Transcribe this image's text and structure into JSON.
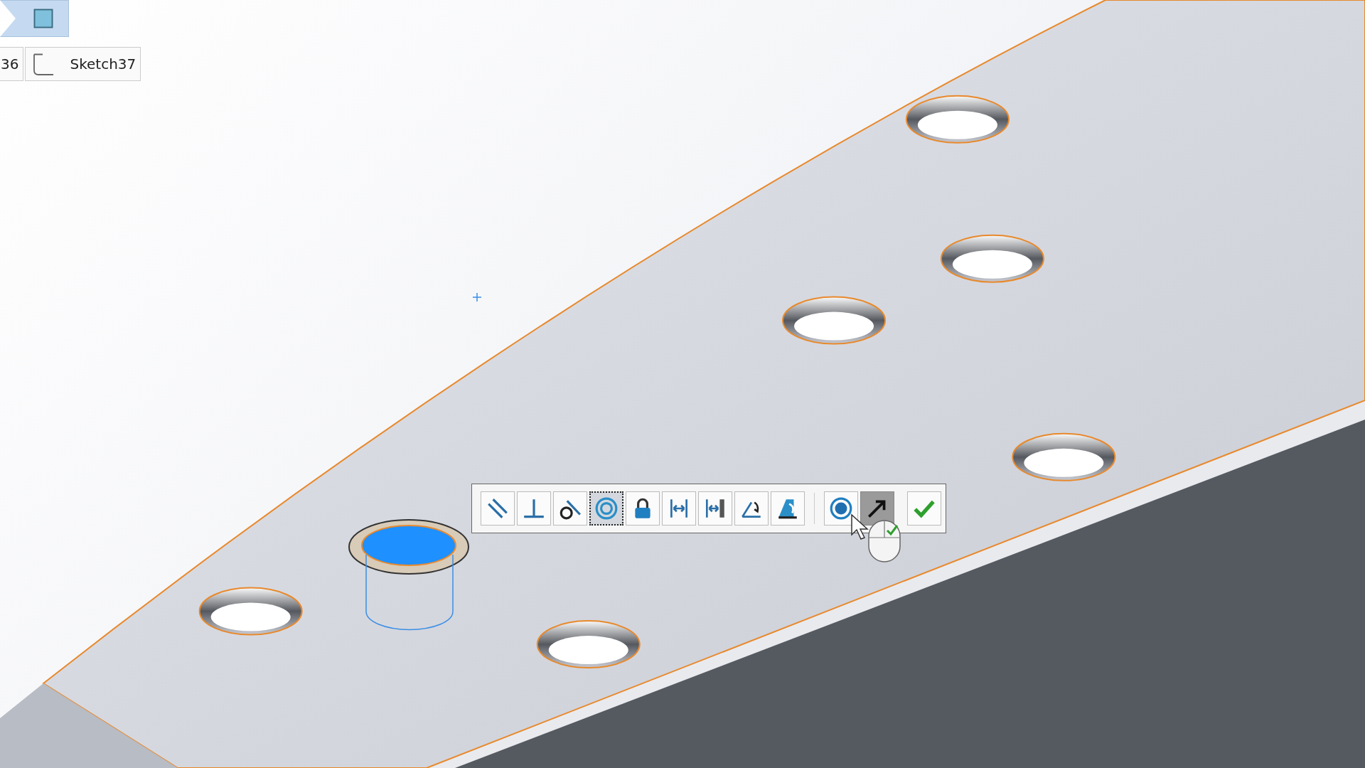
{
  "breadcrumb": {
    "kind": "part"
  },
  "sketch_tabs": [
    {
      "label": "36"
    },
    {
      "label": "Sketch37"
    }
  ],
  "toolbar": {
    "relations": [
      {
        "kind": "parallel",
        "selected": false
      },
      {
        "kind": "perpendicular",
        "selected": false
      },
      {
        "kind": "tangent",
        "selected": false
      },
      {
        "kind": "concentric",
        "selected": true
      },
      {
        "kind": "fix",
        "selected": false
      },
      {
        "kind": "horizontal-distance",
        "selected": false
      },
      {
        "kind": "distance",
        "selected": false
      },
      {
        "kind": "angle",
        "selected": false
      },
      {
        "kind": "angle-fill",
        "selected": false
      }
    ],
    "options": [
      {
        "kind": "circle",
        "on": false
      },
      {
        "kind": "arrow",
        "on": true
      }
    ],
    "confirm": {
      "kind": "check"
    }
  }
}
